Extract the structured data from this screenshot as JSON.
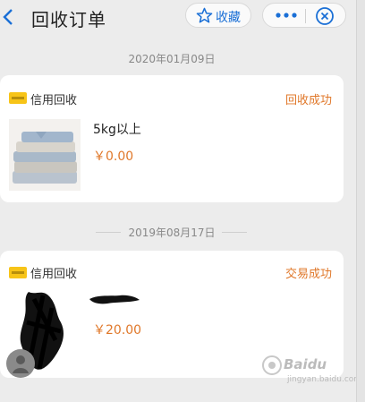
{
  "header": {
    "title": "回收订单",
    "favorite_label": "收藏",
    "icons": {
      "back": "chevron-left-icon",
      "star": "star-icon",
      "more": "more-dots-icon",
      "close": "close-circle-icon"
    },
    "accent_color": "#1a6fd6"
  },
  "orders": [
    {
      "date": "2020年01月09日",
      "category": "信用回收",
      "status": "回收成功",
      "item_title": "5kg以上",
      "price": "￥0.00"
    },
    {
      "date": "2019年08月17日",
      "category": "信用回收",
      "status": "交易成功",
      "item_title": "",
      "price": "￥20.00"
    }
  ],
  "colors": {
    "price": "#e0782a",
    "status": "#e0782a",
    "badge": "#f7c418"
  },
  "watermark": {
    "brand": "Baidu",
    "sub": "jingyan.baidu.com"
  }
}
